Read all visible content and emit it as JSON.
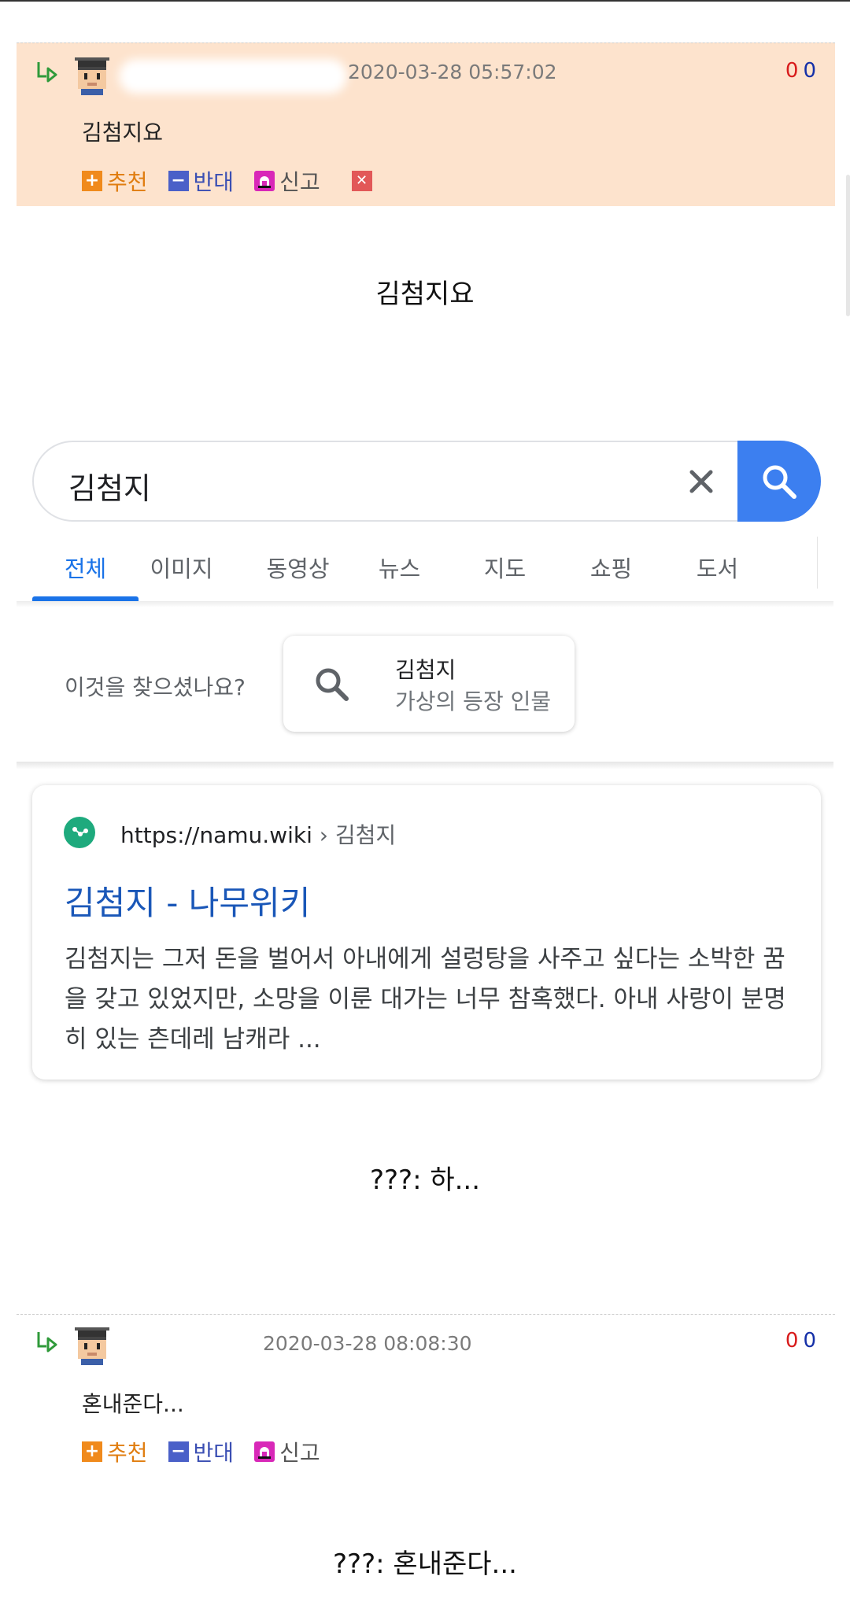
{
  "comments": [
    {
      "date": "2020-03-28 05:57:02",
      "votes_up": "0",
      "votes_down": "0",
      "text": "김첨지요",
      "highlighted": true,
      "show_delete": true
    },
    {
      "date": "2020-03-28 08:08:30",
      "votes_up": "0",
      "votes_down": "0",
      "text": "혼내준다...",
      "highlighted": false,
      "show_delete": false
    }
  ],
  "actions": {
    "recommend": "추천",
    "oppose": "반대",
    "report": "신고"
  },
  "captions": {
    "first": "김첨지요",
    "second": "???: 하...",
    "third": "???: 혼내준다..."
  },
  "search": {
    "query": "김첨지",
    "tabs": [
      "전체",
      "이미지",
      "동영상",
      "뉴스",
      "지도",
      "쇼핑",
      "도서"
    ],
    "active_tab": "전체",
    "did_you_mean": {
      "label": "이것을 찾으셨나요?",
      "title": "김첨지",
      "subtitle": "가상의 등장 인물"
    },
    "result": {
      "url": "https://namu.wiki",
      "breadcrumb": "› 김첨지",
      "title": "김첨지 - 나무위키",
      "snippet": "김첨지는 그저 돈을 벌어서 아내에게 설렁탕을 사주고 싶다는 소박한 꿈을 갖고 있었지만, 소망을 이룬 대가는 너무 참혹했다. 아내 사랑이 분명히 있는 츤데레 남캐라 ..."
    }
  },
  "colors": {
    "highlight_bg": "#fde3cd",
    "recommend": "#e07d10",
    "oppose": "#3b4fb3",
    "google_blue": "#1a73e8",
    "search_button": "#3c7ff0",
    "result_title": "#1a57b8"
  }
}
